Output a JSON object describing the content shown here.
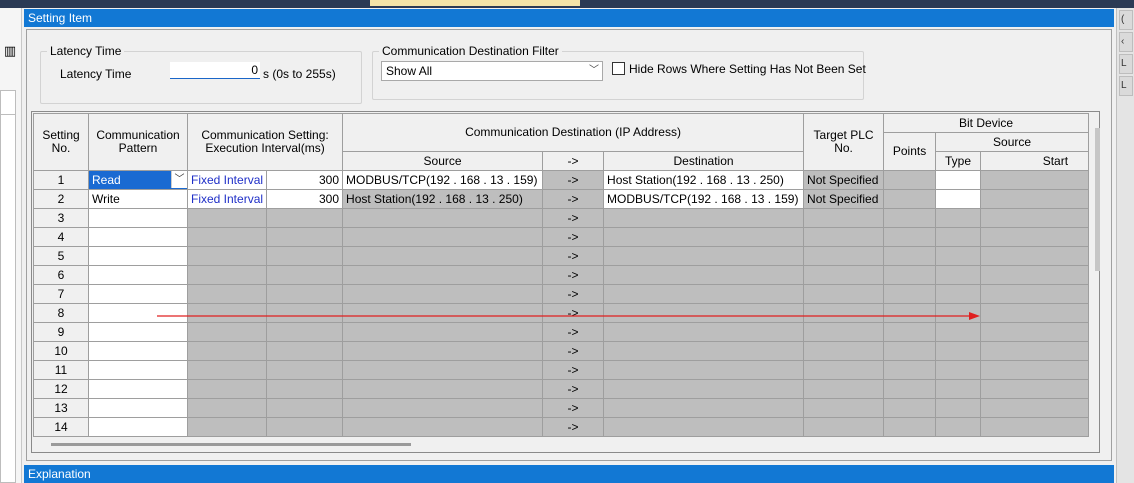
{
  "panel": {
    "title": "Setting Item"
  },
  "latency": {
    "group_label": "Latency Time",
    "field_label": "Latency Time",
    "value": "0",
    "unit": "s (0s to 255s)"
  },
  "filter": {
    "group_label": "Communication Destination Filter",
    "selected": "Show All",
    "hide_rows_label": "Hide Rows Where Setting Has Not Been Set"
  },
  "grid": {
    "headers": {
      "setting_no": "Setting No.",
      "comm_pattern": "Communication Pattern",
      "comm_setting": "Communication Setting: Execution Interval(ms)",
      "comm_dest": "Communication Destination (IP Address)",
      "source": "Source",
      "arrow": "->",
      "destination": "Destination",
      "target_plc": "Target PLC No.",
      "bit_device": "Bit Device",
      "points": "Points",
      "bit_source": "Source",
      "type": "Type",
      "start": "Start"
    },
    "rows": [
      {
        "no": "1",
        "pattern": "Read",
        "mode": "Fixed Interval",
        "interval": "300",
        "source": "MODBUS/TCP(192 . 168 . 13 . 159)",
        "arrow": "->",
        "destination": "Host Station(192 . 168 . 13 . 250)",
        "target": "Not Specified"
      },
      {
        "no": "2",
        "pattern": "Write",
        "mode": "Fixed Interval",
        "interval": "300",
        "source": "Host Station(192 . 168 . 13 . 250)",
        "arrow": "->",
        "destination": "MODBUS/TCP(192 . 168 . 13 . 159)",
        "target": "Not Specified"
      },
      {
        "no": "3",
        "arrow": "->"
      },
      {
        "no": "4",
        "arrow": "->"
      },
      {
        "no": "5",
        "arrow": "->"
      },
      {
        "no": "6",
        "arrow": "->"
      },
      {
        "no": "7",
        "arrow": "->"
      },
      {
        "no": "8",
        "arrow": "->"
      },
      {
        "no": "9",
        "arrow": "->"
      },
      {
        "no": "10",
        "arrow": "->"
      },
      {
        "no": "11",
        "arrow": "->"
      },
      {
        "no": "12",
        "arrow": "->"
      },
      {
        "no": "13",
        "arrow": "->"
      },
      {
        "no": "14",
        "arrow": "->"
      }
    ]
  },
  "explanation": {
    "title": "Explanation"
  },
  "colors": {
    "accent": "#1278d4",
    "selection": "#1a6ad2",
    "disabled_cell": "#bebebe",
    "link_text": "#1f2fc7",
    "annotation_arrow": "#e02020"
  }
}
